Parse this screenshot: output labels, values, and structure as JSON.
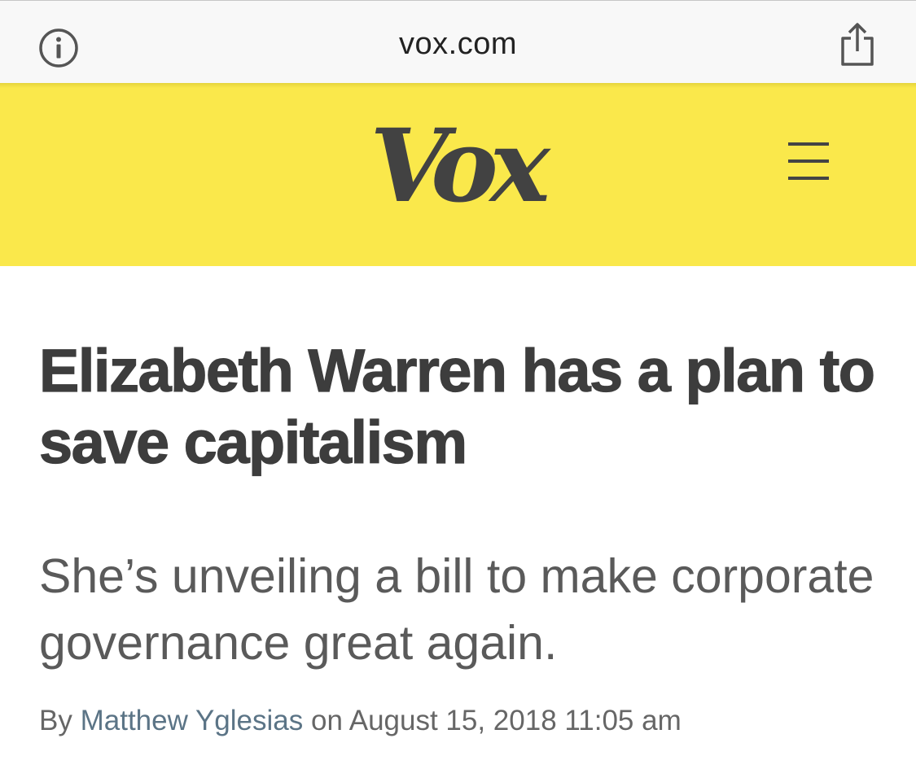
{
  "browser": {
    "url": "vox.com",
    "info_icon": "info-circle-icon",
    "share_icon": "share-icon"
  },
  "site": {
    "logo": "Vox",
    "menu_icon": "hamburger-menu-icon",
    "header_color": "#fae84b"
  },
  "article": {
    "headline": "Elizabeth Warren has a plan to save capitalism",
    "dek": "She’s unveiling a bill to make corporate governance great again.",
    "byline_prefix": "By",
    "author": "Matthew Yglesias",
    "byline_on": "on",
    "date": "August 15, 2018 11:05 am"
  }
}
